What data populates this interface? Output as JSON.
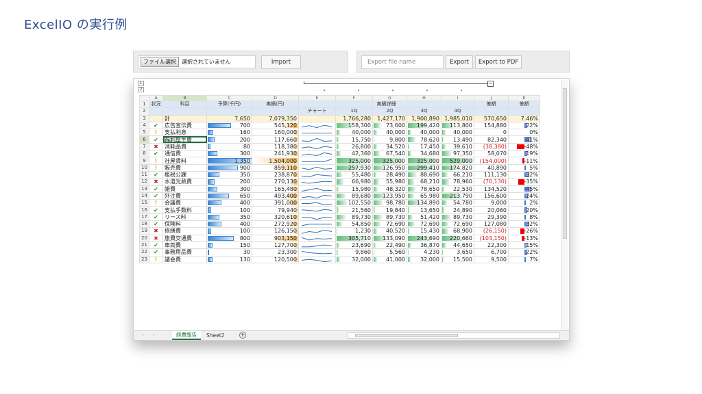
{
  "title": "ExcelIO の実行例",
  "toolbar_left": {
    "file_button": "ファイル選択",
    "file_status": "選択されていません",
    "import_label": "Import"
  },
  "toolbar_right": {
    "export_placeholder": "Export file name",
    "export_label": "Export",
    "export_pdf_label": "Export to PDF"
  },
  "outline_levels": [
    "1",
    "2"
  ],
  "columns": [
    "",
    "A",
    "B",
    "C",
    "D",
    "E",
    "F",
    "G",
    "H",
    "I",
    "J",
    "K"
  ],
  "header1": [
    "状況",
    "科目",
    "予算(千円)",
    "実績(円)",
    "実績詳細",
    "",
    "",
    "",
    "",
    "差額",
    "差額"
  ],
  "header2": [
    "",
    "",
    "",
    "",
    "チャート",
    "1Q",
    "2Q",
    "3Q",
    "4Q",
    "",
    ""
  ],
  "total_row": {
    "label": "計",
    "budget": "7,650",
    "actual": "7,079,350",
    "q1": "1,766,280",
    "q2": "1,427,170",
    "q3": "1,900,890",
    "q4": "1,985,010",
    "diff": "570,650",
    "pct": "7.46%"
  },
  "rows": [
    {
      "n": "4",
      "s": "ok",
      "name": "広告宣伝費",
      "budget": "700",
      "actual": "545,120",
      "q1": "158,300",
      "q2": "73,600",
      "q3": "199,420",
      "q4": "113,800",
      "diff": "154,880",
      "pct": "22%",
      "bud_v": 0.52,
      "act_v": 0.33,
      "q1v": 0.45,
      "q2v": 0.2,
      "q3v": 0.55,
      "q4v": 0.33,
      "pv": 0.22,
      "spark": [
        0.3,
        0.6,
        0.2,
        0.7,
        0.4
      ]
    },
    {
      "n": "5",
      "s": "warn",
      "name": "支払利息",
      "budget": "160",
      "actual": "160,000",
      "q1": "40,000",
      "q2": "40,000",
      "q3": "40,000",
      "q4": "40,000",
      "diff": "0",
      "pct": "0%",
      "bud_v": 0.12,
      "act_v": 0.1,
      "q1v": 0.1,
      "q2v": 0.1,
      "q3v": 0.1,
      "q4v": 0.1,
      "pv": 0,
      "spark": [
        0.5,
        0.5,
        0.5,
        0.5,
        0.5
      ]
    },
    {
      "n": "6",
      "s": "ok",
      "name": "福利厚生費",
      "budget": "200",
      "actual": "117,660",
      "q1": "15,750",
      "q2": "9,800",
      "q3": "78,620",
      "q4": "13,490",
      "diff": "82,340",
      "pct": "41%",
      "bud_v": 0.15,
      "act_v": 0.07,
      "q1v": 0.05,
      "q2v": 0.03,
      "q3v": 0.22,
      "q4v": 0.04,
      "pv": 0.41,
      "spark": [
        0.3,
        0.2,
        0.8,
        0.2,
        0.3
      ]
    },
    {
      "n": "7",
      "s": "ng",
      "name": "消耗品費",
      "budget": "80",
      "actual": "118,380",
      "q1": "26,800",
      "q2": "34,520",
      "q3": "17,450",
      "q4": "39,610",
      "diff": "(38,380)",
      "pct": "-48%",
      "bud_v": 0.06,
      "act_v": 0.07,
      "q1v": 0.08,
      "q2v": 0.1,
      "q3v": 0.05,
      "q4v": 0.11,
      "pv": -0.48,
      "spark": [
        0.4,
        0.6,
        0.2,
        0.7,
        0.5
      ]
    },
    {
      "n": "8",
      "s": "ok",
      "name": "通信費",
      "budget": "300",
      "actual": "241,930",
      "q1": "42,360",
      "q2": "67,540",
      "q3": "34,680",
      "q4": "97,350",
      "diff": "58,070",
      "pct": "19%",
      "bud_v": 0.22,
      "act_v": 0.15,
      "q1v": 0.12,
      "q2v": 0.19,
      "q3v": 0.1,
      "q4v": 0.27,
      "pv": 0.19,
      "spark": [
        0.3,
        0.5,
        0.2,
        0.8,
        0.5
      ]
    },
    {
      "n": "9",
      "s": "warn",
      "name": "社屋賃料",
      "budget": "1,350",
      "actual": "1,504,000",
      "q1": "325,000",
      "q2": "325,000",
      "q3": "325,000",
      "q4": "529,000",
      "diff": "(154,000)",
      "pct": "-11%",
      "bud_v": 1,
      "act_v": 0.93,
      "q1v": 0.9,
      "q2v": 0.9,
      "q3v": 0.9,
      "q4v": 1,
      "pv": -0.11,
      "spark": [
        0.4,
        0.4,
        0.4,
        0.4,
        0.9
      ]
    },
    {
      "n": "10",
      "s": "warn",
      "name": "販売費",
      "budget": "900",
      "actual": "859,110",
      "q1": "257,930",
      "q2": "126,950",
      "q3": "299,410",
      "q4": "174,820",
      "diff": "40,890",
      "pct": "5%",
      "bud_v": 0.67,
      "act_v": 0.53,
      "q1v": 0.72,
      "q2v": 0.35,
      "q3v": 0.83,
      "q4v": 0.48,
      "pv": 0.05,
      "spark": [
        0.6,
        0.3,
        0.8,
        0.4,
        0.5
      ]
    },
    {
      "n": "11",
      "s": "ok",
      "name": "租税公課",
      "budget": "350",
      "actual": "238,870",
      "q1": "55,480",
      "q2": "28,490",
      "q3": "88,690",
      "q4": "66,210",
      "diff": "111,130",
      "pct": "32%",
      "bud_v": 0.26,
      "act_v": 0.15,
      "q1v": 0.15,
      "q2v": 0.08,
      "q3v": 0.25,
      "q4v": 0.18,
      "pv": 0.32,
      "spark": [
        0.4,
        0.2,
        0.7,
        0.5,
        0.4
      ]
    },
    {
      "n": "12",
      "s": "ng",
      "name": "水道光熱費",
      "budget": "200",
      "actual": "270,130",
      "q1": "66,980",
      "q2": "55,980",
      "q3": "68,210",
      "q4": "78,960",
      "diff": "(70,130)",
      "pct": "-35%",
      "bud_v": 0.15,
      "act_v": 0.17,
      "q1v": 0.19,
      "q2v": 0.16,
      "q3v": 0.19,
      "q4v": 0.22,
      "pv": -0.35,
      "spark": [
        0.5,
        0.3,
        0.5,
        0.7,
        0.6
      ]
    },
    {
      "n": "13",
      "s": "ok",
      "name": "雑費",
      "budget": "300",
      "actual": "165,480",
      "q1": "15,980",
      "q2": "48,320",
      "q3": "78,650",
      "q4": "22,530",
      "diff": "134,520",
      "pct": "45%",
      "bud_v": 0.22,
      "act_v": 0.1,
      "q1v": 0.05,
      "q2v": 0.13,
      "q3v": 0.22,
      "q4v": 0.06,
      "pv": 0.45,
      "spark": [
        0.2,
        0.5,
        0.8,
        0.3,
        0.4
      ]
    },
    {
      "n": "14",
      "s": "ok",
      "name": "外注費",
      "budget": "650",
      "actual": "493,400",
      "q1": "89,680",
      "q2": "123,950",
      "q3": "65,980",
      "q4": "213,790",
      "diff": "156,600",
      "pct": "24%",
      "bud_v": 0.48,
      "act_v": 0.31,
      "q1v": 0.25,
      "q2v": 0.34,
      "q3v": 0.18,
      "q4v": 0.6,
      "pv": 0.24,
      "spark": [
        0.3,
        0.5,
        0.2,
        0.8,
        0.6
      ]
    },
    {
      "n": "15",
      "s": "warn",
      "name": "会議費",
      "budget": "400",
      "actual": "391,000",
      "q1": "102,550",
      "q2": "98,780",
      "q3": "134,890",
      "q4": "54,780",
      "diff": "9,000",
      "pct": "2%",
      "bud_v": 0.3,
      "act_v": 0.24,
      "q1v": 0.28,
      "q2v": 0.27,
      "q3v": 0.37,
      "q4v": 0.15,
      "pv": 0.02,
      "spark": [
        0.5,
        0.5,
        0.7,
        0.2,
        0.4
      ]
    },
    {
      "n": "16",
      "s": "ok",
      "name": "支払手数料",
      "budget": "100",
      "actual": "79,940",
      "q1": "21,560",
      "q2": "19,840",
      "q3": "13,650",
      "q4": "24,890",
      "diff": "20,060",
      "pct": "20%",
      "bud_v": 0.07,
      "act_v": 0.05,
      "q1v": 0.06,
      "q2v": 0.05,
      "q3v": 0.04,
      "q4v": 0.07,
      "pv": 0.2,
      "spark": [
        0.6,
        0.5,
        0.3,
        0.7,
        0.5
      ]
    },
    {
      "n": "17",
      "s": "ok",
      "name": "リース料",
      "budget": "350",
      "actual": "320,610",
      "q1": "89,730",
      "q2": "89,730",
      "q3": "51,420",
      "q4": "89,730",
      "diff": "29,390",
      "pct": "8%",
      "bud_v": 0.26,
      "act_v": 0.2,
      "q1v": 0.25,
      "q2v": 0.25,
      "q3v": 0.14,
      "q4v": 0.25,
      "pv": 0.08,
      "spark": [
        0.6,
        0.6,
        0.2,
        0.6,
        0.5
      ]
    },
    {
      "n": "18",
      "s": "ok",
      "name": "保険料",
      "budget": "400",
      "actual": "272,920",
      "q1": "54,850",
      "q2": "72,690",
      "q3": "72,690",
      "q4": "72,690",
      "diff": "127,080",
      "pct": "32%",
      "bud_v": 0.3,
      "act_v": 0.17,
      "q1v": 0.15,
      "q2v": 0.2,
      "q3v": 0.2,
      "q4v": 0.2,
      "pv": 0.32,
      "spark": [
        0.3,
        0.6,
        0.6,
        0.6,
        0.6
      ]
    },
    {
      "n": "19",
      "s": "ng",
      "name": "修繕費",
      "budget": "100",
      "actual": "126,150",
      "q1": "1,230",
      "q2": "40,520",
      "q3": "15,430",
      "q4": "68,900",
      "diff": "(26,150)",
      "pct": "-26%",
      "bud_v": 0.07,
      "act_v": 0.08,
      "q1v": 0.01,
      "q2v": 0.11,
      "q3v": 0.04,
      "q4v": 0.19,
      "pv": -0.26,
      "spark": [
        0.1,
        0.5,
        0.3,
        0.8,
        0.5
      ]
    },
    {
      "n": "20",
      "s": "ng",
      "name": "旅費交通費",
      "budget": "800",
      "actual": "903,150",
      "q1": "305,710",
      "q2": "133,090",
      "q3": "243,690",
      "q4": "220,660",
      "diff": "(103,150)",
      "pct": "-13%",
      "bud_v": 0.59,
      "act_v": 0.56,
      "q1v": 0.85,
      "q2v": 0.37,
      "q3v": 0.67,
      "q4v": 0.61,
      "pv": -0.13,
      "spark": [
        0.8,
        0.3,
        0.6,
        0.5,
        0.6
      ]
    },
    {
      "n": "21",
      "s": "ok",
      "name": "車両費",
      "budget": "150",
      "actual": "127,700",
      "q1": "23,690",
      "q2": "22,490",
      "q3": "36,870",
      "q4": "44,650",
      "diff": "22,300",
      "pct": "15%",
      "bud_v": 0.11,
      "act_v": 0.08,
      "q1v": 0.07,
      "q2v": 0.06,
      "q3v": 0.1,
      "q4v": 0.12,
      "pv": 0.15,
      "spark": [
        0.3,
        0.3,
        0.5,
        0.7,
        0.5
      ]
    },
    {
      "n": "22",
      "s": "ok",
      "name": "事務用品費",
      "budget": "30",
      "actual": "23,300",
      "q1": "9,860",
      "q2": "5,560",
      "q3": "4,230",
      "q4": "3,650",
      "diff": "6,700",
      "pct": "22%",
      "bud_v": 0.02,
      "act_v": 0.01,
      "q1v": 0.03,
      "q2v": 0.02,
      "q3v": 0.01,
      "q4v": 0.01,
      "pv": 0.22,
      "spark": [
        0.8,
        0.5,
        0.4,
        0.3,
        0.4
      ]
    },
    {
      "n": "23",
      "s": "warn",
      "name": "諸会費",
      "budget": "130",
      "actual": "120,500",
      "q1": "32,000",
      "q2": "41,000",
      "q3": "32,000",
      "q4": "15,500",
      "diff": "9,500",
      "pct": "7%",
      "bud_v": 0.1,
      "act_v": 0.07,
      "q1v": 0.09,
      "q2v": 0.11,
      "q3v": 0.09,
      "q4v": 0.04,
      "pv": 0.07,
      "spark": [
        0.5,
        0.7,
        0.5,
        0.2,
        0.4
      ]
    }
  ],
  "sheets": {
    "active": "経費報告",
    "other": "Sheet2"
  },
  "colors": {
    "ok": "#2e8b2e",
    "warn": "#e8a300",
    "ng": "#d03030",
    "accent": "#217346"
  },
  "status_glyphs": {
    "ok": "✔",
    "warn": "!",
    "ng": "✖"
  }
}
